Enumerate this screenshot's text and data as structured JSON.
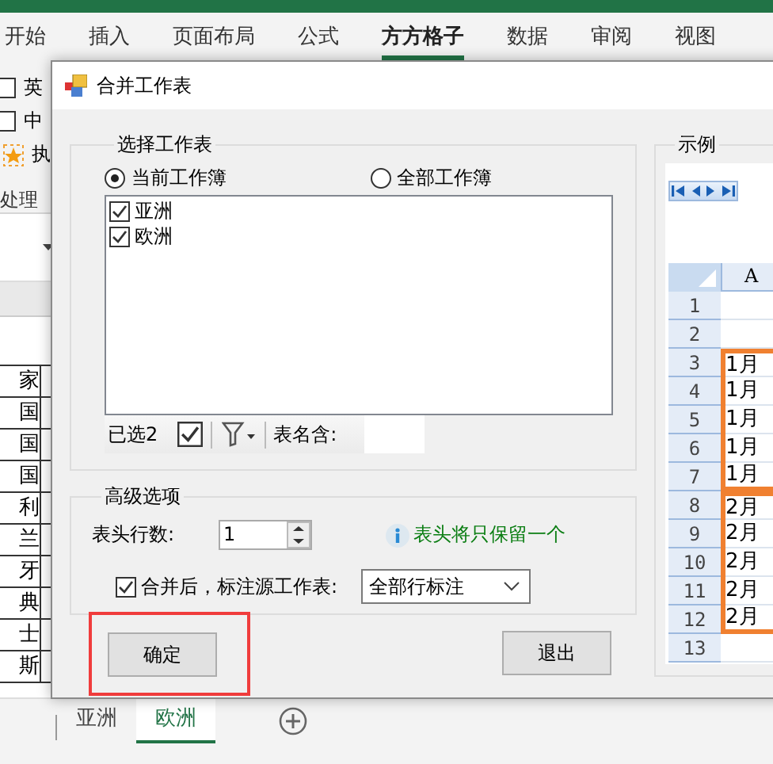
{
  "ribbon": {
    "tabs": [
      {
        "label": "开始",
        "selected": false
      },
      {
        "label": "插入",
        "selected": false
      },
      {
        "label": "页面布局",
        "selected": false
      },
      {
        "label": "公式",
        "selected": false
      },
      {
        "label": "方方格子",
        "selected": true
      },
      {
        "label": "数据",
        "selected": false
      },
      {
        "label": "审阅",
        "selected": false
      },
      {
        "label": "视图",
        "selected": false
      }
    ],
    "checkboxes": [
      {
        "label": "英",
        "checked": false
      },
      {
        "label": "中",
        "checked": false
      }
    ],
    "command": "执",
    "group_label": "处理"
  },
  "sheet": {
    "cells": [
      "家",
      "国",
      "国",
      "国",
      "利",
      "兰",
      "牙",
      "典",
      "士",
      "斯"
    ]
  },
  "dialog": {
    "title": "合并工作表",
    "select_group": {
      "legend": "选择工作表",
      "radios": [
        {
          "label": "当前工作簿",
          "selected": true
        },
        {
          "label": "全部工作簿",
          "selected": false
        }
      ],
      "items": [
        {
          "label": "亚洲",
          "checked": true
        },
        {
          "label": "欧洲",
          "checked": true
        }
      ],
      "selected_count": "已选2",
      "select_all_checked": true,
      "name_filter_label": "表名含:"
    },
    "advanced": {
      "legend": "高级选项",
      "header_rows_label": "表头行数:",
      "header_rows_value": "1",
      "hint": "表头将只保留一个",
      "mark_source": {
        "label": "合并后，标注源工作表:",
        "checked": true
      },
      "mark_mode": "全部行标注"
    },
    "buttons": [
      {
        "label": "确定",
        "highlighted": true
      },
      {
        "label": "退出",
        "highlighted": false
      }
    ],
    "example": {
      "legend": "示例",
      "column": "A",
      "rows": [
        {
          "kind": "row",
          "num": "1"
        },
        {
          "kind": "row",
          "num": "2"
        },
        {
          "kind": "block",
          "rows": [
            {
              "num": "3",
              "text": "1月"
            },
            {
              "num": "4",
              "text": "1月"
            },
            {
              "num": "5",
              "text": "1月"
            },
            {
              "num": "6",
              "text": "1月"
            },
            {
              "num": "7",
              "text": "1月"
            }
          ]
        },
        {
          "kind": "block",
          "rows": [
            {
              "num": "8",
              "text": "2月"
            },
            {
              "num": "9",
              "text": "2月"
            },
            {
              "num": "10",
              "text": "2月"
            },
            {
              "num": "11",
              "text": "2月"
            },
            {
              "num": "12",
              "text": "2月"
            }
          ]
        },
        {
          "kind": "row",
          "num": "13"
        }
      ]
    }
  },
  "sheet_tabs": [
    {
      "label": "亚洲",
      "selected": false
    },
    {
      "label": "欧洲",
      "selected": true
    }
  ]
}
